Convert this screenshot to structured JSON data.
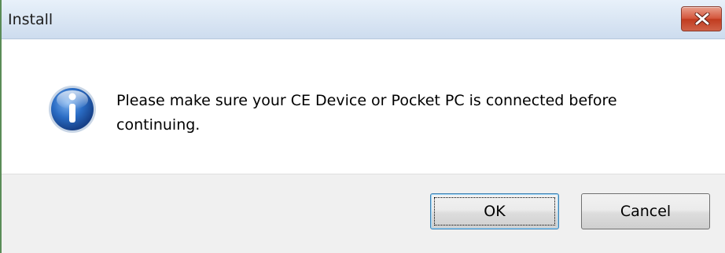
{
  "window": {
    "title": "Install",
    "close_icon": "close-x-icon",
    "accent_color": "#c13b1f"
  },
  "message": {
    "icon": "info-icon",
    "text": "Please make sure your CE Device or Pocket PC is connected before continuing."
  },
  "buttons": {
    "ok_label": "OK",
    "cancel_label": "Cancel"
  },
  "colors": {
    "titlebar": "#cddcee",
    "footer": "#f0f0f0",
    "info_icon": "#1f5fb3"
  }
}
